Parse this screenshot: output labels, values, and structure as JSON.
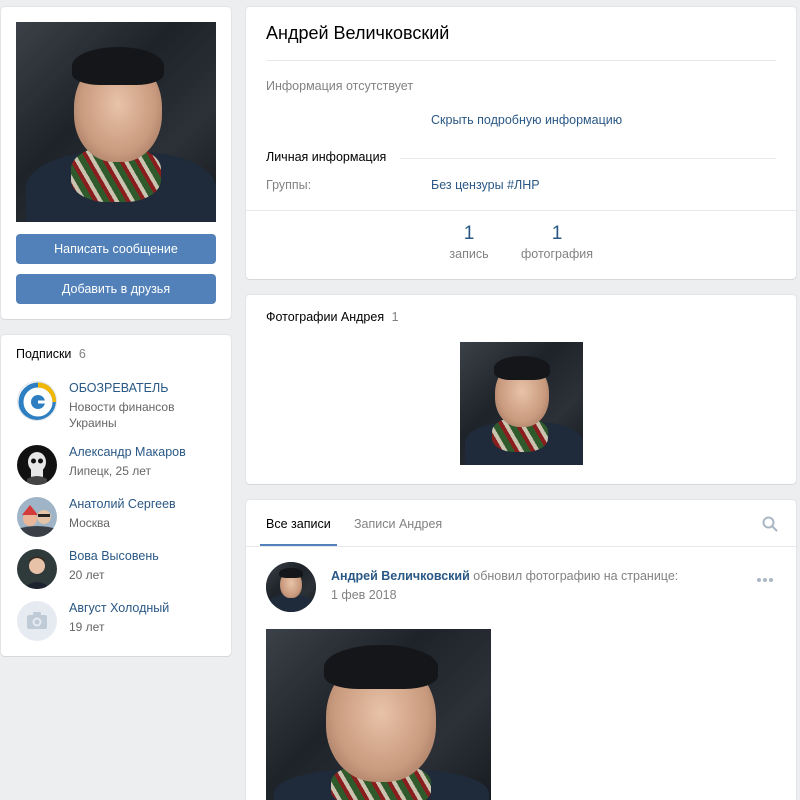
{
  "profile": {
    "name": "Андрей Величковский",
    "no_info": "Информация отсутствует",
    "hide_details": "Скрыть подробную информацию",
    "personal_section": "Личная информация",
    "groups_label": "Группы:",
    "groups_value": "Без цензуры #ЛНР",
    "counters": [
      {
        "count": "1",
        "label": "запись"
      },
      {
        "count": "1",
        "label": "фотография"
      }
    ]
  },
  "actions": {
    "message": "Написать сообщение",
    "add_friend": "Добавить в друзья"
  },
  "subscriptions": {
    "title": "Подписки",
    "count": "6",
    "items": [
      {
        "name": "ОБОЗРЕВАТЕЛЬ",
        "desc": "Новости финансов Украины",
        "icon": "obozrevatel-logo"
      },
      {
        "name": "Александр Макаров",
        "desc": "Липецк, 25 лет",
        "icon": "skull-avatar"
      },
      {
        "name": "Анатолий Сергеев",
        "desc": "Москва",
        "icon": "user-avatar"
      },
      {
        "name": "Вова Высовень",
        "desc": "20 лет",
        "icon": "user-avatar"
      },
      {
        "name": "Август Холодный",
        "desc": "19 лет",
        "icon": "camera-icon"
      }
    ]
  },
  "photos": {
    "title": "Фотографии Андрея",
    "count": "1"
  },
  "wall": {
    "tabs": [
      "Все записи",
      "Записи Андрея"
    ],
    "active_tab": 0,
    "post": {
      "author": "Андрей Величковский",
      "action": "обновил фотографию на странице:",
      "date": "1 фев 2018"
    }
  },
  "colors": {
    "accent": "#5181b8",
    "link": "#2a5885",
    "background": "#edeef0"
  }
}
